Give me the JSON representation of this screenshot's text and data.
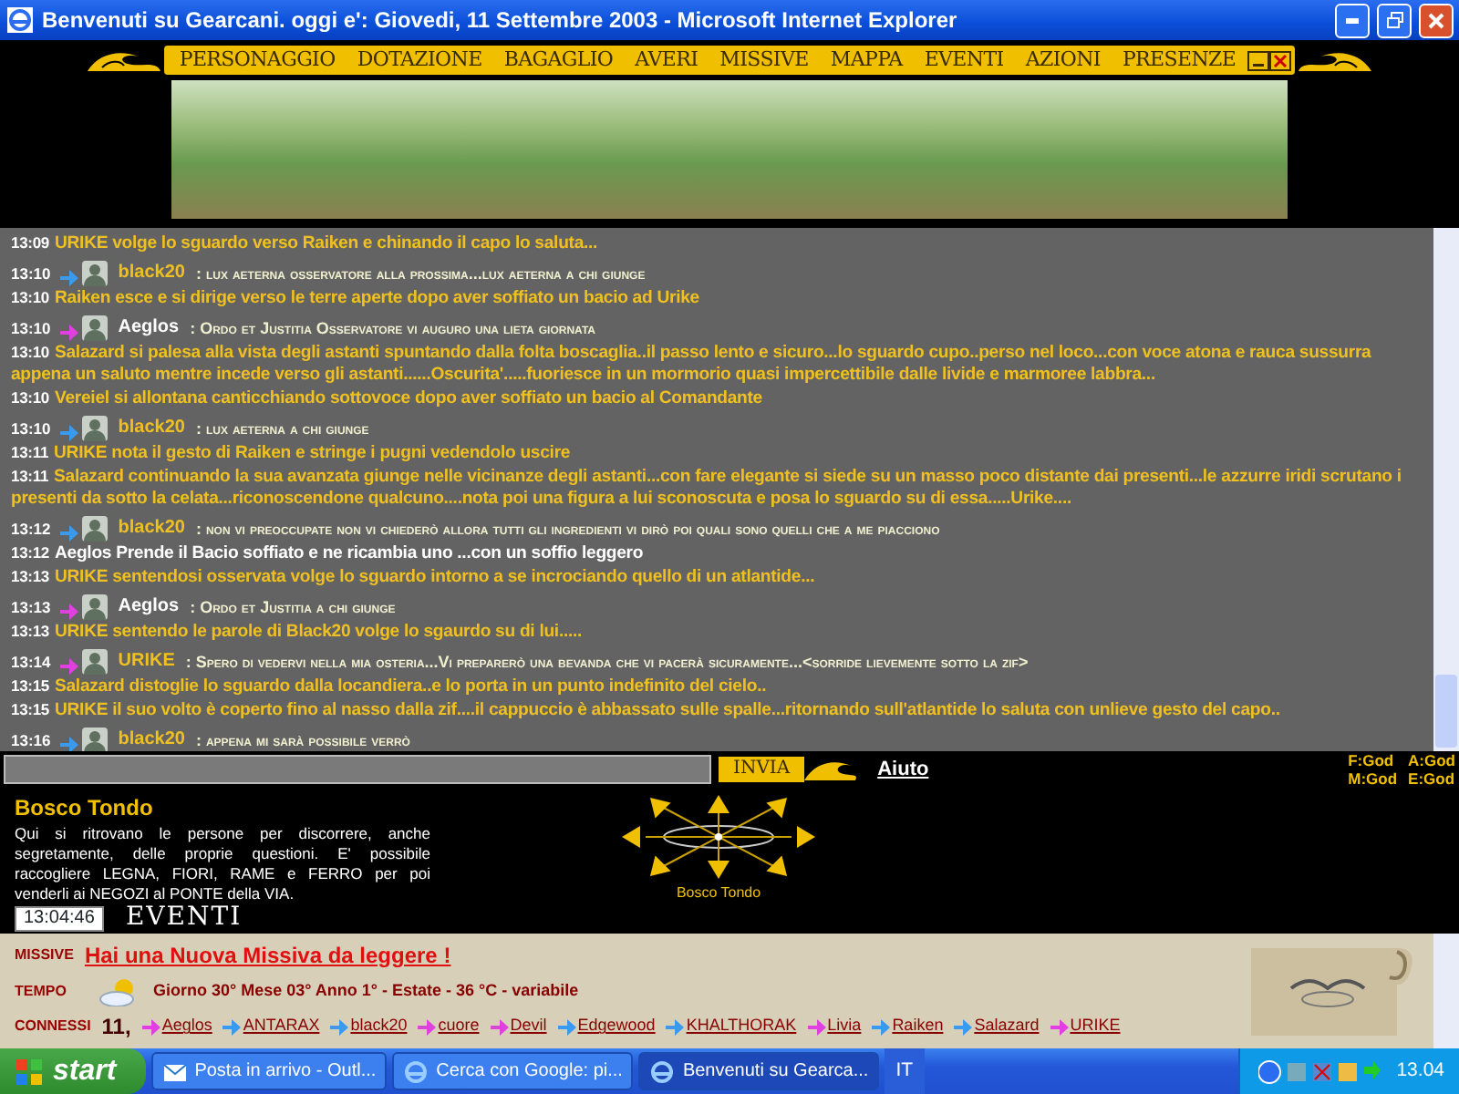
{
  "window": {
    "title": "Benvenuti su Gearcani. oggi e': Giovedi, 11 Settembre 2003 - Microsoft Internet Explorer"
  },
  "menu": [
    "PERSONAGGIO",
    "DOTAZIONE",
    "BAGAGLIO",
    "AVERI",
    "MISSIVE",
    "MAPPA",
    "EVENTI",
    "AZIONI",
    "PRESENZE"
  ],
  "chat": [
    {
      "kind": "action",
      "time": "13:09",
      "color": "#f0c020",
      "text": "URIKE volge lo sguardo verso Raiken e chinando il capo lo saluta..."
    },
    {
      "kind": "speech",
      "time": "13:10",
      "color": "#3a9af0",
      "speaker": {
        "name": "black20",
        "color": "#f0c020"
      },
      "text": ": lux aeterna osservatore alla prossima...lux aeterna a chi giunge"
    },
    {
      "kind": "action",
      "time": "13:10",
      "color": "#f0c020",
      "text": "Raiken esce e si dirige verso le terre aperte dopo aver soffiato un bacio ad Urike"
    },
    {
      "kind": "speech",
      "time": "13:10",
      "color": "#e040e0",
      "speaker": {
        "name": "Aeglos",
        "color": "#ffffff"
      },
      "text": ": Ordo et Justitia Osservatore vi auguro una lieta giornata"
    },
    {
      "kind": "action",
      "time": "13:10",
      "color": "#f0c020",
      "text": "Salazard si palesa alla vista degli astanti spuntando dalla folta boscaglia..il passo lento e sicuro...lo sguardo cupo..perso nel loco...con voce atona e rauca sussurra appena un saluto mentre incede verso gli astanti......Oscurita'.....fuoriesce in un mormorio quasi impercettibile dalle livide e marmoree labbra..."
    },
    {
      "kind": "action",
      "time": "13:10",
      "color": "#f0c020",
      "text": "Vereiel si allontana canticchiando sottovoce dopo aver soffiato un bacio al Comandante"
    },
    {
      "kind": "speech",
      "time": "13:10",
      "color": "#3a9af0",
      "speaker": {
        "name": "black20",
        "color": "#f0c020"
      },
      "text": ": lux aeterna a chi giunge"
    },
    {
      "kind": "action",
      "time": "13:11",
      "color": "#f0c020",
      "text": "URIKE nota il gesto di Raiken e stringe i pugni vedendolo uscire"
    },
    {
      "kind": "action",
      "time": "13:11",
      "color": "#f0c020",
      "text": "Salazard continuando la sua avanzata giunge nelle vicinanze degli astanti...con fare elegante si siede su un masso poco distante dai presenti...le azzurre iridi scrutano i presenti da sotto la celata...riconoscendone qualcuno....nota poi una figura a lui sconoscuta e posa lo sguardo su di essa.....Urike...."
    },
    {
      "kind": "speech",
      "time": "13:12",
      "color": "#3a9af0",
      "speaker": {
        "name": "black20",
        "color": "#f0c020"
      },
      "text": ": non vi preoccupate non vi chiederò allora tutti gli ingredienti vi dirò poi quali sono quelli che a me piacciono"
    },
    {
      "kind": "action",
      "time": "13:12",
      "color": "#ffffff",
      "text": "Aeglos Prende il Bacio soffiato e ne ricambia uno ...con un soffio leggero"
    },
    {
      "kind": "action",
      "time": "13:13",
      "color": "#f0c020",
      "text": "URIKE sentendosi osservata volge lo sguardo intorno a se incrociando quello di un atlantide..."
    },
    {
      "kind": "speech",
      "time": "13:13",
      "color": "#e040e0",
      "speaker": {
        "name": "Aeglos",
        "color": "#ffffff"
      },
      "text": ": Ordo et Justitia a chi giunge"
    },
    {
      "kind": "action",
      "time": "13:13",
      "color": "#f0c020",
      "text": "URIKE sentendo le parole di Black20 volge lo sgaurdo su di lui....."
    },
    {
      "kind": "speech",
      "time": "13:14",
      "color": "#e040e0",
      "speaker": {
        "name": "URIKE",
        "color": "#f0c020"
      },
      "text": ": Spero di vedervi nella mia osteria...Vi preparerò una bevanda che vi pacerà sicuramente...<sorride lievemente sotto la zif>"
    },
    {
      "kind": "action",
      "time": "13:15",
      "color": "#f0c020",
      "text": "Salazard distoglie lo sguardo dalla locandiera..e lo porta in un punto indefinito del cielo.."
    },
    {
      "kind": "action",
      "time": "13:15",
      "color": "#f0c020",
      "text": "URIKE il suo volto è coperto fino al nasso dalla zif....il cappuccio è abbassato sulle spalle...ritornando sull'atlantide lo saluta con unlieve gesto del capo.."
    },
    {
      "kind": "speech",
      "time": "13:16",
      "color": "#3a9af0",
      "speaker": {
        "name": "black20",
        "color": "#f0c020"
      },
      "text": ": appena mi sarà possibile verrò"
    }
  ],
  "input": {
    "button": "INVIA",
    "help": "Aiuto"
  },
  "stats": [
    "F:God",
    "A:God",
    "M:God",
    "E:God"
  ],
  "location": {
    "title": "Bosco Tondo",
    "description": "Qui si ritrovano le persone per discorrere, anche segretamente, delle proprie questioni. E' possibile raccogliere LEGNA, FIORI, RAME e FERRO per poi venderli ai NEGOZI al PONTE della VIA.",
    "map_label": "Bosco Tondo"
  },
  "clock": "13:04:46",
  "events_title": "EVENTI",
  "events": {
    "missive": {
      "label": "MISSIVE",
      "text": "Hai una Nuova Missiva da leggere !"
    },
    "weather": {
      "label": "TEMPO",
      "text": "Giorno 30° Mese 03° Anno 1° - Estate - 36 °C - variabile"
    },
    "online": {
      "label": "CONNESSI",
      "count": "11,",
      "users": [
        {
          "name": "Aeglos",
          "color": "#e040e0"
        },
        {
          "name": "ANTARAX",
          "color": "#3a9af0"
        },
        {
          "name": "black20",
          "color": "#3a9af0"
        },
        {
          "name": "cuore",
          "color": "#e040e0"
        },
        {
          "name": "Devil",
          "color": "#e040e0"
        },
        {
          "name": "Edgewood",
          "color": "#3a9af0"
        },
        {
          "name": "KHALTHORAK",
          "color": "#3a9af0"
        },
        {
          "name": "Livia",
          "color": "#e040e0"
        },
        {
          "name": "Raiken",
          "color": "#3a9af0"
        },
        {
          "name": "Salazard",
          "color": "#3a9af0"
        },
        {
          "name": "URIKE",
          "color": "#e040e0"
        }
      ]
    }
  },
  "taskbar": {
    "start": "start",
    "tasks": [
      {
        "label": "Posta in arrivo - Outl...",
        "selected": false
      },
      {
        "label": "Cerca con Google: pi...",
        "selected": false
      },
      {
        "label": "Benvenuti su Gearca...",
        "selected": true
      }
    ],
    "language": "IT",
    "clock": "13.04"
  }
}
